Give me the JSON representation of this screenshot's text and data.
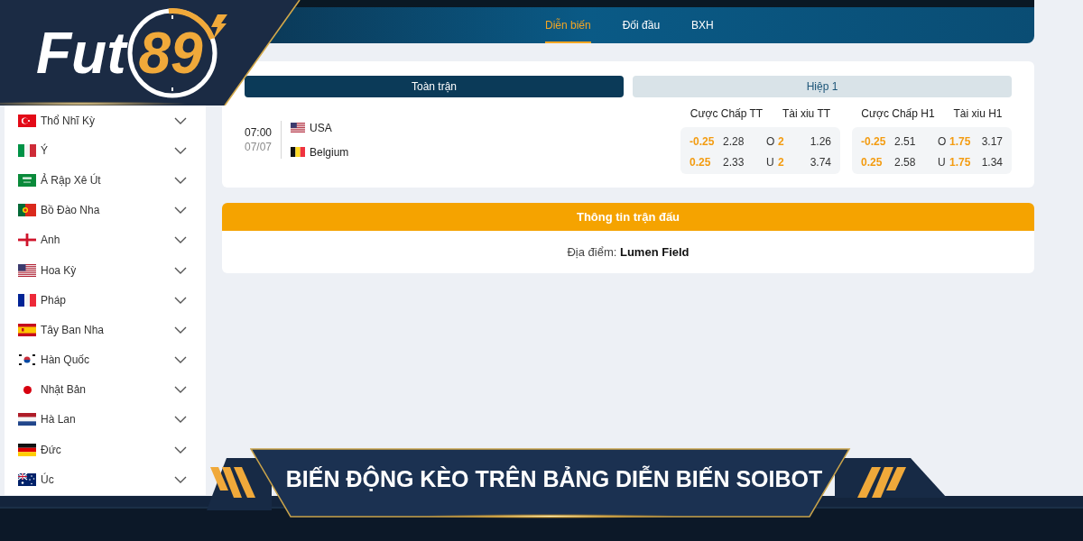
{
  "logo": {
    "text": "Fut",
    "accent": "89"
  },
  "nav_tabs": [
    {
      "label": "Diễn biến",
      "selected": true
    },
    {
      "label": "Đối đầu",
      "selected": false
    },
    {
      "label": "BXH",
      "selected": false
    }
  ],
  "sidebar": {
    "items": [
      {
        "label": "Thổ Nhĩ Kỳ",
        "kind": "turkey"
      },
      {
        "label": "Ý",
        "kind": "italy"
      },
      {
        "label": "Ả Rập Xê Út",
        "kind": "saudi"
      },
      {
        "label": "Bồ Đào Nha",
        "kind": "portugal"
      },
      {
        "label": "Anh",
        "kind": "england"
      },
      {
        "label": "Hoa Kỳ",
        "kind": "usa"
      },
      {
        "label": "Pháp",
        "kind": "france"
      },
      {
        "label": "Tây Ban Nha",
        "kind": "spain"
      },
      {
        "label": "Hàn Quốc",
        "kind": "korea"
      },
      {
        "label": "Nhật Bản",
        "kind": "japan"
      },
      {
        "label": "Hà Lan",
        "kind": "netherlands"
      },
      {
        "label": "Đức",
        "kind": "germany"
      },
      {
        "label": "Úc",
        "kind": "australia"
      }
    ]
  },
  "match_card": {
    "period_tabs": [
      {
        "label": "Toàn trận",
        "selected": true
      },
      {
        "label": "Hiệp 1",
        "selected": false
      }
    ],
    "match": {
      "time": "07:00",
      "date": "07/07",
      "teams": [
        {
          "name": "USA",
          "kind": "usa"
        },
        {
          "name": "Belgium",
          "kind": "belgium"
        }
      ]
    },
    "markets": [
      {
        "headers": [
          "Cược Chấp TT",
          "Tài xiu TT"
        ],
        "rows": [
          {
            "handicap": "-0.25",
            "handicap_odds": "2.28",
            "side": "O",
            "total": "2",
            "total_odds": "1.26"
          },
          {
            "handicap": "0.25",
            "handicap_odds": "2.33",
            "side": "U",
            "total": "2",
            "total_odds": "3.74"
          }
        ]
      },
      {
        "headers": [
          "Cược Chấp H1",
          "Tài xiu H1"
        ],
        "rows": [
          {
            "handicap": "-0.25",
            "handicap_odds": "2.51",
            "side": "O",
            "total": "1.75",
            "total_odds": "3.17"
          },
          {
            "handicap": "0.25",
            "handicap_odds": "2.58",
            "side": "U",
            "total": "1.75",
            "total_odds": "1.34"
          }
        ]
      }
    ]
  },
  "match_info": {
    "title": "Thông tin trận đấu",
    "venue": "Địa điểm: **Lumen Field**"
  },
  "banner": {
    "title": "BIẾN ĐỘNG KÈO TRÊN BẢNG DIỄN BIẾN SOIBOT"
  }
}
